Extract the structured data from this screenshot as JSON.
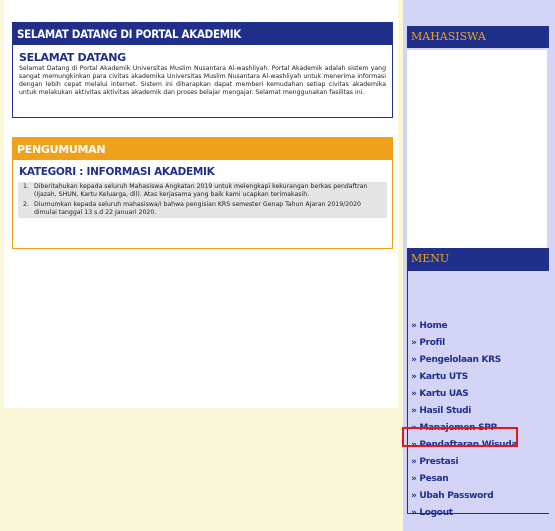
{
  "welcome": {
    "header": "SELAMAT DATANG DI PORTAL AKADEMIK",
    "title": "SELAMAT DATANG",
    "text": "Selamat Datang di Portal Akademik Universitas Muslim Nusantara Al-washliyah. Portal Akademik adalah sistem yang sangat memungkinkan para civitas akademika Universitas Muslim Nusantara Al-washliyah untuk menerima informasi dengan lebih cepat melalui internet. Sistem ini diharapkan dapat memberi kemudahan setiap civitas akademika untuk melakukan aktivitas aktivitas akademik dan proses belajar mengajar. Selamat menggunakan fasilitas ini."
  },
  "announcement": {
    "header": "PENGUMUMAN",
    "category": "KATEGORI : INFORMASI AKADEMIK",
    "items": [
      {
        "num": "1.",
        "text": "Diberitahukan kepada seluruh Mahasiswa Angkatan 2019 untuk melengkapi kekurangan berkas pendaftran (Ijazah, SHUN, Kartu Keluarga, dll). Atas kerjasama yang baik kami ucapkan terimakasih."
      },
      {
        "num": "2.",
        "text": "Diumumkan kepada seluruh mahasiswa/i bahwa pengisian KRS semester Genap Tahun Ajaran 2019/2020 dimulai tanggal 13 s.d 22 Januari 2020."
      }
    ]
  },
  "sidebar": {
    "mahasiswa_header": "MAHASISWA",
    "menu_header": "MENU",
    "menu_items": [
      "» Home",
      "» Profil",
      "» Pengelolaan KRS",
      "» Kartu UTS",
      "» Kartu UAS",
      "» Hasil Studi",
      "» Manajemen SPP",
      "» Pendaftaran Wisuda",
      "» Prestasi",
      "» Pesan",
      "» Ubah Password",
      "» Logout"
    ]
  },
  "colors": {
    "navy": "#1f2f8a",
    "orange": "#f0a11b",
    "cream": "#fbf8d9",
    "lavender": "#d4d4f7",
    "highlight_red": "#e2181f"
  }
}
